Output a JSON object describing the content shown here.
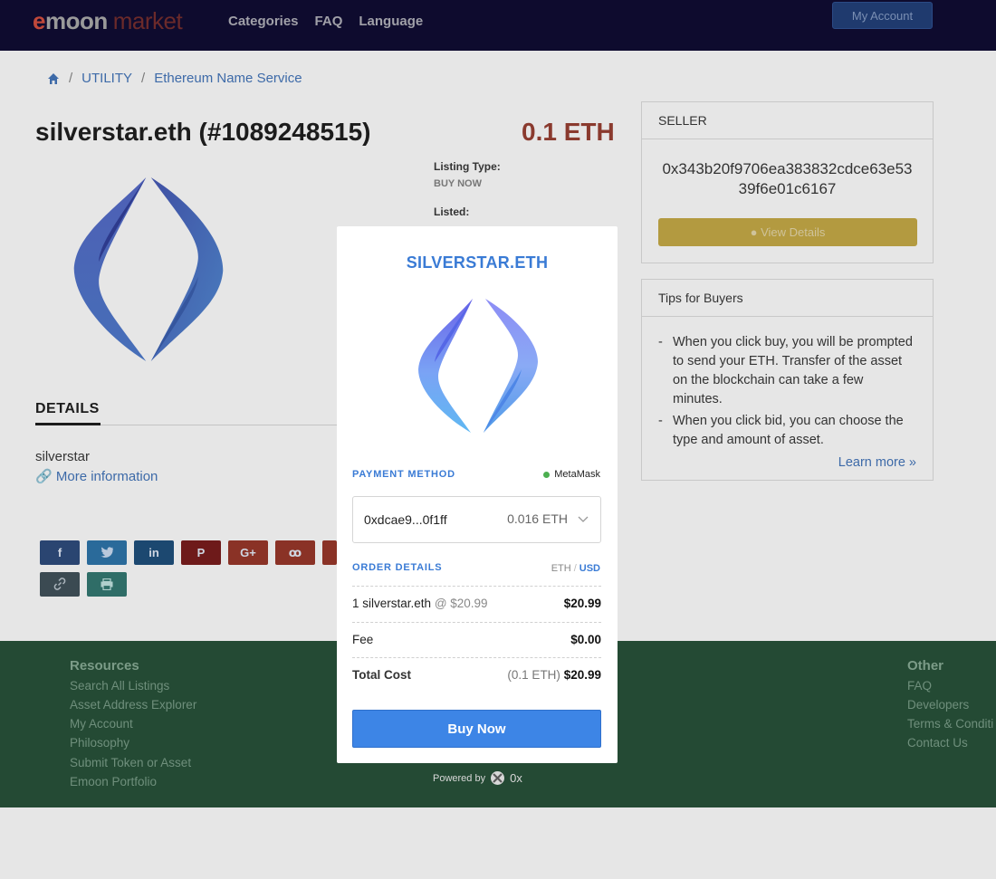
{
  "header": {
    "logo_emoon_e": "e",
    "logo_emoon_rest": "moon",
    "logo_market": "market",
    "nav": [
      "Categories",
      "FAQ",
      "Language"
    ],
    "account_label": "My Account"
  },
  "breadcrumb": {
    "sep": "/",
    "items": [
      "UTILITY",
      "Ethereum Name Service"
    ]
  },
  "listing": {
    "title": "silverstar.eth (#1089248515)",
    "price": "0.1 ETH",
    "listing_type_label": "Listing Type:",
    "listing_type_value": "BUY NOW",
    "listed_label": "Listed:"
  },
  "details": {
    "heading": "DETAILS",
    "name": "silverstar",
    "more_info": "More information"
  },
  "share": {
    "buttons": [
      {
        "icon": "facebook-icon",
        "glyph": "f",
        "color": "#2a4571"
      },
      {
        "icon": "twitter-icon",
        "glyph": "🐦",
        "color": "#2a6a9a"
      },
      {
        "icon": "linkedin-icon",
        "glyph": "in",
        "color": "#1c4870"
      },
      {
        "icon": "pinterest-icon",
        "glyph": "P",
        "color": "#6e1a1a"
      },
      {
        "icon": "google-plus-icon",
        "glyph": "G+",
        "color": "#8a3226"
      },
      {
        "icon": "stumbleupon-icon",
        "glyph": "ꝏ",
        "color": "#8a3226"
      },
      {
        "icon": "link-icon",
        "glyph": "🔗",
        "color": "#3b4a52"
      },
      {
        "icon": "print-icon",
        "glyph": "⎙",
        "color": "#2f6d67"
      }
    ]
  },
  "seller": {
    "heading": "SELLER",
    "address": "0x343b20f9706ea383832cdce63e5339f6e01c6167",
    "view_details": "View Details"
  },
  "tips": {
    "heading": "Tips for Buyers",
    "items": [
      "When you click buy, you will be prompted to send your ETH. Transfer of the asset on the blockchain can take a few minutes.",
      "When you click bid, you can choose the type and amount of asset."
    ],
    "learn_more": "Learn more »"
  },
  "footer": {
    "resources_heading": "Resources",
    "resources": [
      "Search All Listings",
      "Asset Address Explorer",
      "My Account",
      "Philosophy",
      "Submit Token or Asset",
      "Emoon Portfolio"
    ],
    "other_heading": "Other",
    "other": [
      "FAQ",
      "Developers",
      "Terms & Conditi",
      "Contact Us"
    ]
  },
  "modal": {
    "title": "SILVERSTAR.ETH",
    "payment_method_label": "PAYMENT METHOD",
    "wallet_name": "MetaMask",
    "wallet_address": "0xdcae9...0f1ff",
    "wallet_balance": "0.016 ETH",
    "order_details_label": "ORDER DETAILS",
    "currency_eth": "ETH",
    "currency_sep": "/",
    "currency_usd": "USD",
    "line_item_label": "1 silverstar.eth",
    "line_item_unit": "@ $20.99",
    "line_item_amount": "$20.99",
    "fee_label": "Fee",
    "fee_amount": "$0.00",
    "total_label": "Total Cost",
    "total_eth": "(0.1 ETH)",
    "total_amount": "$20.99",
    "buy_label": "Buy Now"
  },
  "powered": {
    "label": "Powered by",
    "brand": "0x"
  },
  "colors": {
    "accent": "#3a7bd5",
    "buy_button": "#3d85e6",
    "footer": "#244a34",
    "header": "#0e0b2e"
  }
}
